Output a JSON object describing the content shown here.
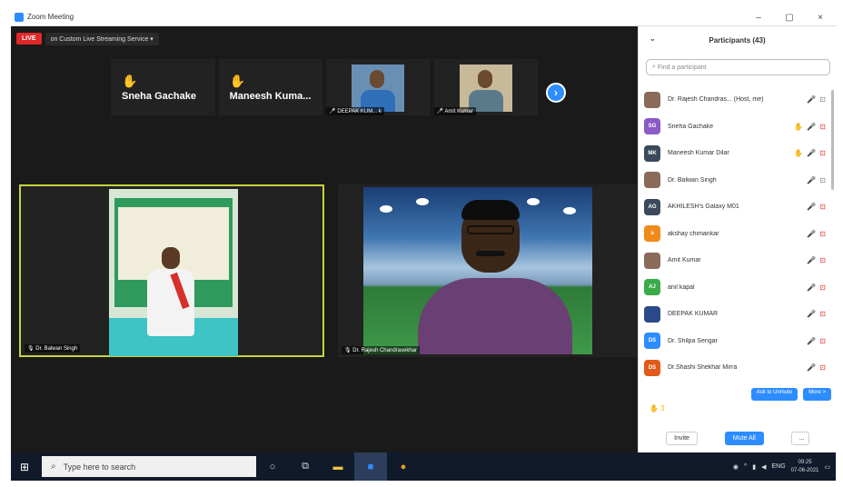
{
  "window": {
    "title": "Zoom Meeting",
    "minimize": "–",
    "maximize": "▢",
    "close": "×"
  },
  "meeting": {
    "live_badge": "LIVE",
    "stream_label": "on Custom Live Streaming Service",
    "stream_chevron": "▾",
    "strip_tiles": [
      {
        "type": "name",
        "name": "Sneha Gachake"
      },
      {
        "type": "name",
        "name": "Maneesh Kuma..."
      },
      {
        "type": "video",
        "label": "DEEPAK KUM... k"
      },
      {
        "type": "video",
        "label": "Amit Kumar"
      }
    ],
    "active_speaker": {
      "label": "Dr. Balwan Singh"
    },
    "second_video": {
      "label": "Dr. Rajesh Chandrasekhar"
    }
  },
  "participants": {
    "title": "Participants (43)",
    "search_placeholder": "Find a participant",
    "list": [
      {
        "name": "Dr. Rajesh Chandras... (Host, me)",
        "avatar": "",
        "avatar_color": "#8a6a58",
        "hand": false,
        "mic": "on"
      },
      {
        "name": "Sneha Gachake",
        "avatar": "SG",
        "avatar_color": "#8b5bc7",
        "hand": true,
        "mic": "muted"
      },
      {
        "name": "Maneesh Kumar Dilar",
        "avatar": "MK",
        "avatar_color": "#3a4a5c",
        "hand": true,
        "mic": "muted"
      },
      {
        "name": "Dr. Balwan Singh",
        "avatar": "",
        "avatar_color": "#8a6a58",
        "hand": false,
        "mic": "on"
      },
      {
        "name": "AKHILESH's Galaxy M01",
        "avatar": "AG",
        "avatar_color": "#3a4a5c",
        "hand": false,
        "mic": "muted"
      },
      {
        "name": "akshay chimankar",
        "avatar": "a",
        "avatar_color": "#f08a1a",
        "hand": false,
        "mic": "muted"
      },
      {
        "name": "Amit Kumar",
        "avatar": "",
        "avatar_color": "#8a6a58",
        "hand": false,
        "mic": "muted"
      },
      {
        "name": "anil kapal",
        "avatar": "AJ",
        "avatar_color": "#3bab4a",
        "hand": false,
        "mic": "muted"
      },
      {
        "name": "DEEPAK KUMAR",
        "avatar": "",
        "avatar_color": "#2a4a8a",
        "hand": false,
        "mic": "muted"
      },
      {
        "name": "Dr. Shilpa Sengar",
        "avatar": "DS",
        "avatar_color": "#2d8cff",
        "hand": false,
        "mic": "muted"
      },
      {
        "name": "Dr.Shashi Shekhar Mirra",
        "avatar": "DS",
        "avatar_color": "#e05a1a",
        "hand": false,
        "mic": "muted"
      }
    ],
    "action_btn_1": "Ask to Unmute",
    "action_btn_2": "More >",
    "raise_count": "✋ 3",
    "invite": "Invite",
    "mute_all": "Mute All",
    "more": "..."
  },
  "taskbar": {
    "search_placeholder": "Type here to search",
    "lang": "ENG",
    "time": "09:25",
    "date": "07-06-2021"
  }
}
